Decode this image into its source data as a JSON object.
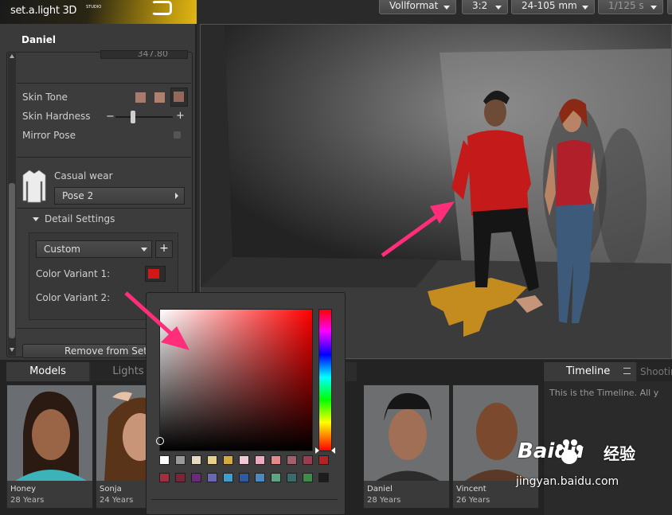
{
  "app": {
    "logo_text": "set.a.light 3D",
    "logo_suffix": "STUDIO"
  },
  "toolbar": {
    "format": "Vollformat",
    "ratio": "3:2",
    "lens": "24-105 mm",
    "shutter": "1/125 s"
  },
  "model_panel": {
    "title": "Daniel",
    "cut_value": "347.80",
    "skin_tone_label": "Skin Tone",
    "skin_hardness_label": "Skin Hardness",
    "mirror_pose_label": "Mirror Pose",
    "clothing_label": "Casual wear",
    "pose_value": "Pose 2",
    "detail_settings_label": "Detail Settings",
    "preset_value": "Custom",
    "color_variant_1_label": "Color Variant 1:",
    "color_variant_2_label": "Color Variant 2:",
    "remove_button": "Remove from Set",
    "skin_hardness_level": 0.3
  },
  "colors": {
    "skin_tones": [
      "#a97b6f",
      "#b0806f",
      "#94695c"
    ],
    "color_variant_1": "#d11818",
    "color_variant_2": "#2b3d55",
    "accent_arrow": "#ff2d7a"
  },
  "bottom_tabs": {
    "models": "Models",
    "lights": "Lights"
  },
  "models": [
    {
      "name": "Honey",
      "age": "28 Years"
    },
    {
      "name": "Sonja",
      "age": "24 Years"
    },
    {
      "name": "Daniel",
      "age": "28 Years"
    },
    {
      "name": "Vincent",
      "age": "26 Years"
    }
  ],
  "timeline": {
    "title": "Timeline",
    "shooting_tab": "Shooting",
    "description": "This is the Timeline. All y"
  },
  "palette": {
    "row1": [
      "#ffffff",
      "#9a9a9a",
      "#e7d9c0",
      "#e8d08a",
      "#d8a93f",
      "#f3c6d3",
      "#ebaabd",
      "#e58a8a",
      "#a45f6a",
      "#9a3d50",
      "#b02424"
    ],
    "row2": [
      "#a0303e",
      "#7a2438",
      "#6a2a7a",
      "#6a68b0",
      "#3f9ec9",
      "#2f5aa0",
      "#4a8ac0",
      "#5fa585",
      "#3a6a6a",
      "#3f8a4a",
      "#1c1c1c"
    ]
  },
  "watermark": {
    "brand": "Bai",
    "brand2": "du",
    "cn": "经验",
    "url": "jingyan.baidu.com"
  }
}
